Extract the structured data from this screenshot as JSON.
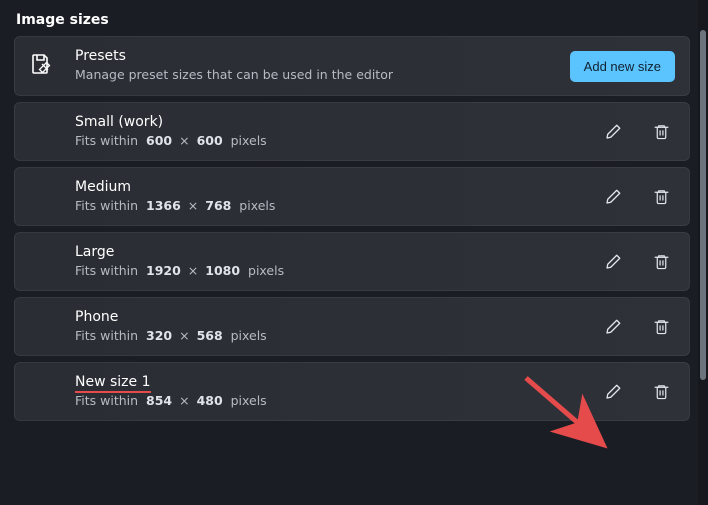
{
  "section": {
    "title": "Image sizes"
  },
  "header": {
    "title": "Presets",
    "subtitle": "Manage preset sizes that can be used in the editor",
    "add_button": "Add new size"
  },
  "fits_prefix": "Fits within",
  "pixels_suffix": "pixels",
  "multiply": "×",
  "rows": [
    {
      "name": "Small (work)",
      "w": "600",
      "h": "600"
    },
    {
      "name": "Medium",
      "w": "1366",
      "h": "768"
    },
    {
      "name": "Large",
      "w": "1920",
      "h": "1080"
    },
    {
      "name": "Phone",
      "w": "320",
      "h": "568"
    },
    {
      "name": "New size 1",
      "w": "854",
      "h": "480",
      "highlight": true
    }
  ]
}
